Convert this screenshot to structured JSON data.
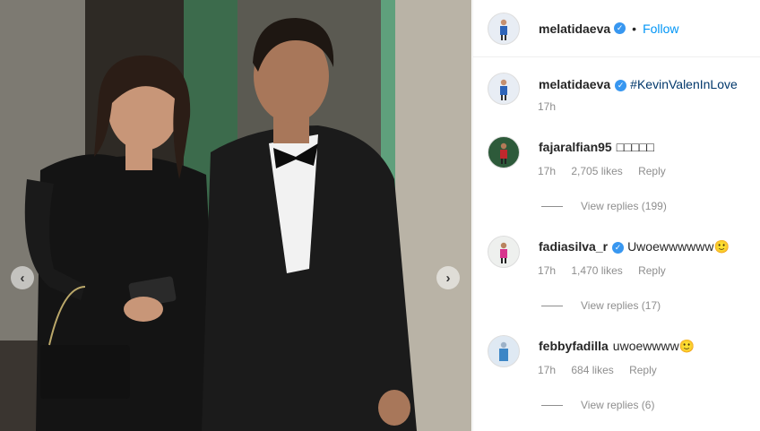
{
  "post": {
    "author": "melatidaeva",
    "follow_label": "Follow",
    "dot": "•",
    "caption_hashtag": "#KevinValenInLove",
    "caption_time": "17h"
  },
  "photo": {
    "prev_glyph": "‹",
    "next_glyph": "›"
  },
  "comments": [
    {
      "user": "fajaralfian95",
      "text": "□□□□□",
      "time": "17h",
      "likes": "2,705 likes",
      "reply": "Reply",
      "view_replies": "View replies (199)"
    },
    {
      "user": "fadiasilva_r",
      "text": "Uwoewwwwww🙂",
      "time": "17h",
      "likes": "1,470 likes",
      "reply": "Reply",
      "view_replies": "View replies (17)"
    },
    {
      "user": "febbyfadilla",
      "text": "uwoewwww🙂",
      "time": "17h",
      "likes": "684 likes",
      "reply": "Reply",
      "view_replies": "View replies (6)"
    }
  ],
  "colors": {
    "accent": "#0095f6",
    "verified": "#3897f0",
    "muted": "#8e8e8e"
  }
}
